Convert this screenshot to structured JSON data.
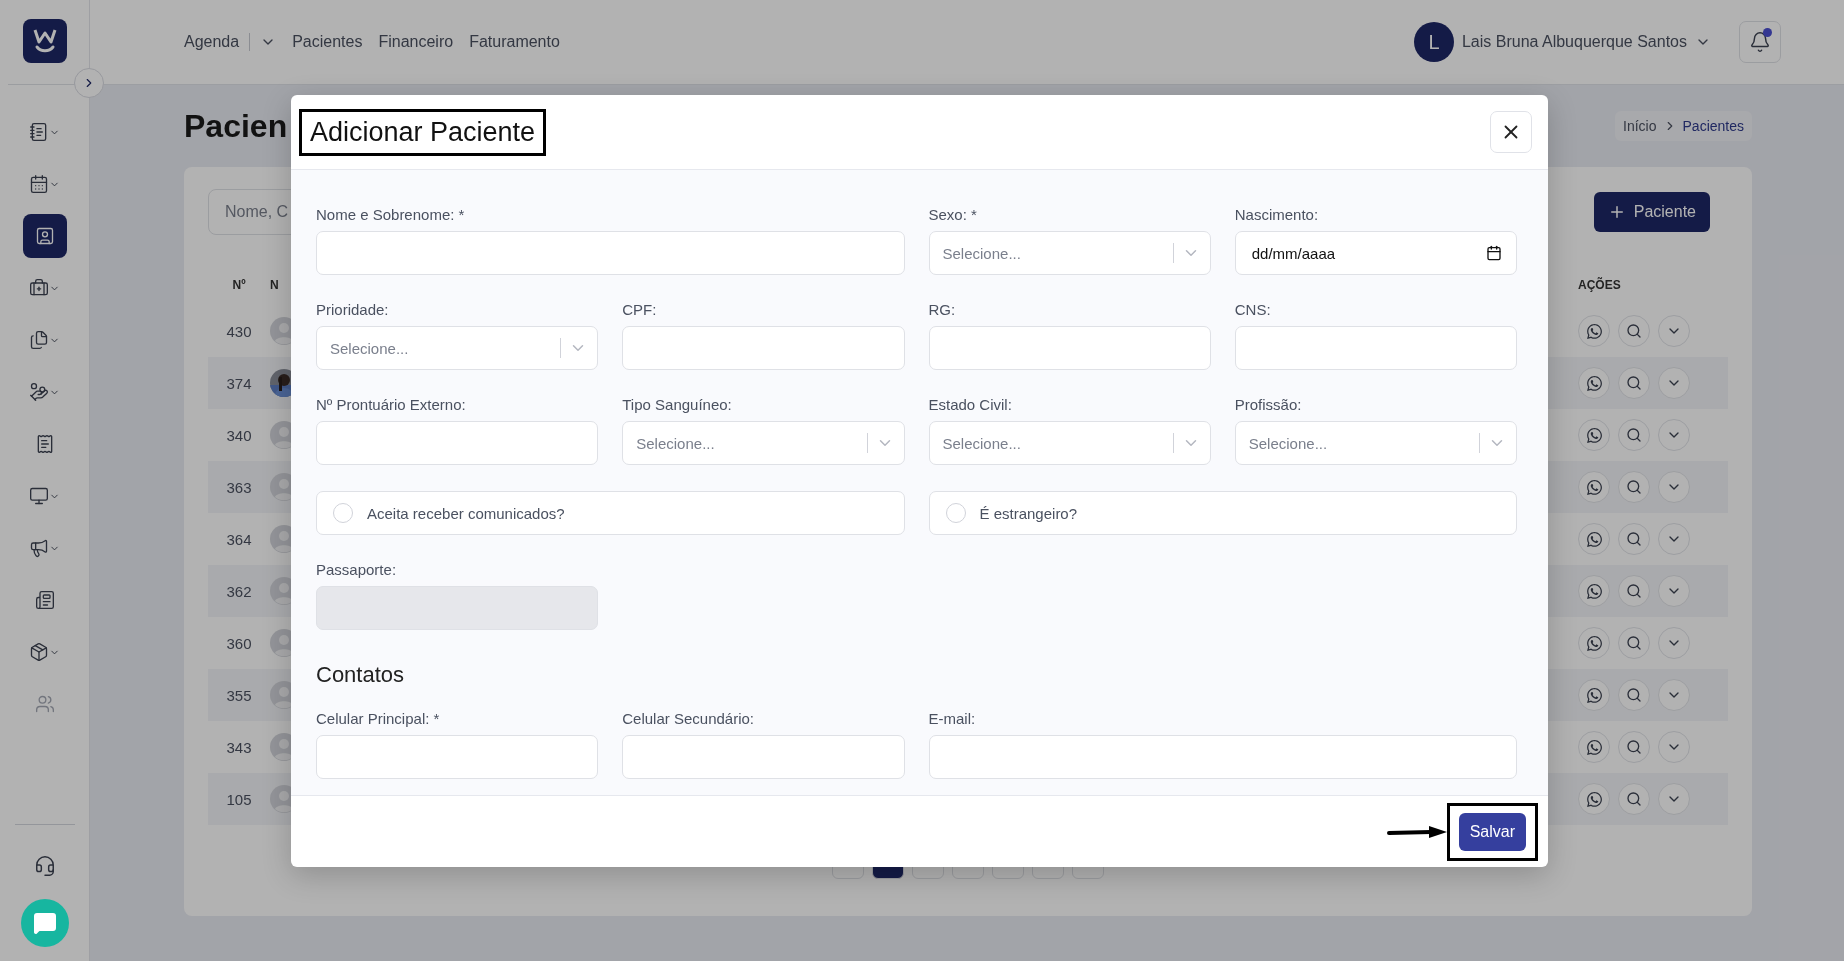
{
  "sidebar": {
    "toggle": true,
    "items": [
      {
        "selected": false,
        "expandable": true
      },
      {
        "selected": false,
        "expandable": true
      },
      {
        "selected": true,
        "expandable": false
      },
      {
        "selected": false,
        "expandable": true
      },
      {
        "selected": false,
        "expandable": true
      },
      {
        "selected": false,
        "expandable": true
      },
      {
        "selected": false,
        "expandable": false
      },
      {
        "selected": false,
        "expandable": true
      },
      {
        "selected": false,
        "expandable": true
      },
      {
        "selected": false,
        "expandable": false
      },
      {
        "selected": false,
        "expandable": true
      },
      {
        "selected": false,
        "expandable": false,
        "disabled": true
      }
    ]
  },
  "topbar": {
    "nav": [
      {
        "label": "Agenda",
        "dropdown": true
      },
      {
        "label": "Pacientes",
        "dropdown": false
      },
      {
        "label": "Financeiro",
        "dropdown": false
      },
      {
        "label": "Faturamento",
        "dropdown": false
      }
    ],
    "user": {
      "initial": "L",
      "name": "Lais Bruna Albuquerque Santos"
    },
    "notifications": true
  },
  "page": {
    "title": "Pacien",
    "breadcrumb": [
      "Início",
      "Pacientes"
    ],
    "search": {
      "placeholder": "Nome, C"
    },
    "add_button": "Paciente",
    "table": {
      "columns": [
        "Nº",
        "N",
        "AÇÕES"
      ],
      "rows": [
        {
          "number": "430",
          "kind": "default"
        },
        {
          "number": "374"
        },
        {
          "number": "340",
          "kind": "default"
        },
        {
          "number": "363",
          "kind": "default"
        },
        {
          "number": "364",
          "kind": "default"
        },
        {
          "number": "362",
          "kind": "default"
        },
        {
          "number": "360",
          "kind": "default"
        },
        {
          "number": "355",
          "kind": "default"
        },
        {
          "number": "343",
          "kind": "default"
        },
        {
          "number": "105",
          "kind": "default"
        }
      ]
    },
    "pagination": [
      {
        "selected": false
      },
      {
        "selected": true
      },
      {
        "selected": false
      },
      {
        "selected": false
      },
      {
        "selected": false
      },
      {
        "selected": false
      },
      {
        "selected": false
      }
    ]
  },
  "modal": {
    "title": "Adicionar Paciente",
    "title_highlighted": true,
    "fields": [
      {
        "kind": "text",
        "label": "Nome e Sobrenome: *",
        "wide": true
      },
      {
        "kind": "select",
        "label": "Sexo: *",
        "placeholder": "Selecione..."
      },
      {
        "kind": "date",
        "label": "Nascimento:",
        "value": "dd/mm/aaaa"
      },
      {
        "kind": "select",
        "label": "Prioridade:",
        "placeholder": "Selecione..."
      },
      {
        "kind": "text",
        "label": "CPF:"
      },
      {
        "kind": "text",
        "label": "RG:"
      },
      {
        "kind": "text",
        "label": "CNS:"
      },
      {
        "kind": "text",
        "label": "Nº Prontuário Externo:"
      },
      {
        "kind": "select",
        "label": "Tipo Sanguíneo:",
        "placeholder": "Selecione..."
      },
      {
        "kind": "select",
        "label": "Estado Civil:",
        "placeholder": "Selecione..."
      },
      {
        "kind": "select",
        "label": "Profissão:",
        "placeholder": "Selecione..."
      },
      {
        "kind": "checkbox",
        "label": "Aceita receber comunicados?",
        "checked": false,
        "wide": true
      },
      {
        "kind": "checkbox",
        "label": "É estrangeiro?",
        "checked": false,
        "wide": true
      },
      {
        "kind": "text",
        "label": "Passaporte:",
        "disabled": true
      },
      {
        "kind": "heading",
        "label": "Contatos"
      },
      {
        "kind": "text",
        "label": "Celular Principal: *"
      },
      {
        "kind": "text",
        "label": "Celular Secundário:"
      },
      {
        "kind": "text",
        "label": "E-mail:",
        "wide": true
      }
    ],
    "save": {
      "label": "Salvar",
      "highlighted": true
    }
  }
}
